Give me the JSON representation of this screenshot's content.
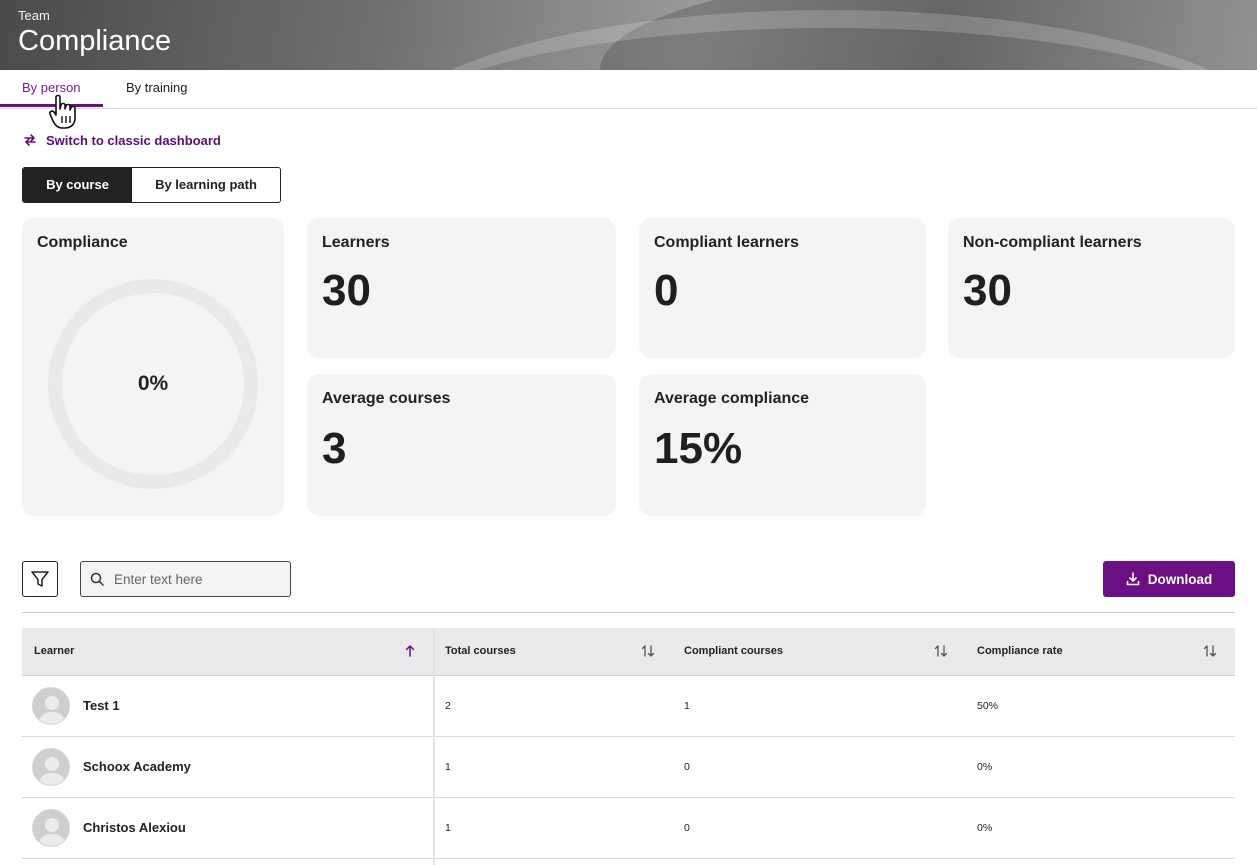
{
  "header": {
    "overline": "Team",
    "title": "Compliance"
  },
  "tabs": [
    {
      "label": "By person",
      "active": true
    },
    {
      "label": "By training",
      "active": false
    }
  ],
  "switch_link": {
    "label": "Switch to classic dashboard",
    "icon": "swap-arrows-icon"
  },
  "view_toggle": {
    "options": [
      "By course",
      "By learning path"
    ],
    "selected": "By course"
  },
  "cards": {
    "compliance": {
      "label": "Compliance",
      "value": "0%",
      "progress": 0
    },
    "learners": {
      "label": "Learners",
      "value": "30"
    },
    "compliant_learners": {
      "label": "Compliant learners",
      "value": "0"
    },
    "non_compliant_learners": {
      "label": "Non-compliant learners",
      "value": "30"
    },
    "average_courses": {
      "label": "Average courses",
      "value": "3"
    },
    "average_compliance": {
      "label": "Average compliance",
      "value": "15%"
    }
  },
  "toolbar": {
    "search_placeholder": "Enter text here",
    "search_value": "",
    "download_label": "Download"
  },
  "table": {
    "columns": [
      "Learner",
      "Total courses",
      "Compliant courses",
      "Compliance rate"
    ],
    "sorted_column": "Learner",
    "sort_direction": "ascending",
    "rows": [
      {
        "learner": "Test 1",
        "total": "2",
        "compliant": "1",
        "rate": "50%"
      },
      {
        "learner": "Schoox Academy",
        "total": "1",
        "compliant": "0",
        "rate": "0%"
      },
      {
        "learner": "Christos Alexiou",
        "total": "1",
        "compliant": "0",
        "rate": "0%"
      }
    ]
  },
  "colors": {
    "accent": "#6b0f82",
    "card_bg": "#f4f4f4",
    "header_bg": "#eaeaec"
  }
}
